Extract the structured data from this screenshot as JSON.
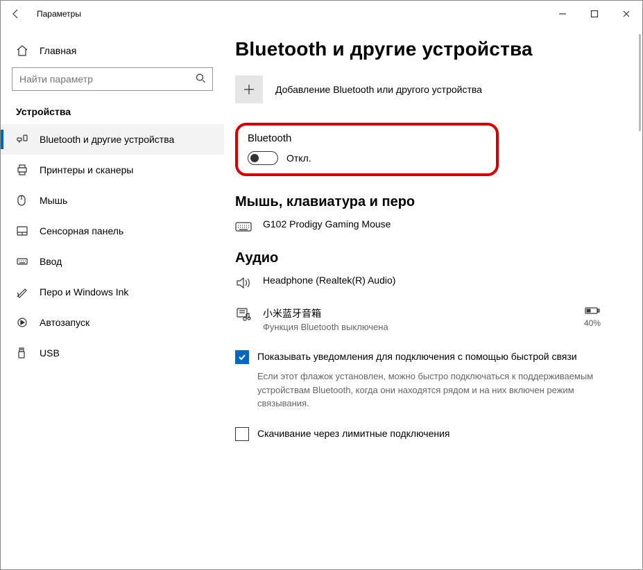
{
  "window": {
    "title": "Параметры"
  },
  "sidebar": {
    "home": "Главная",
    "search_placeholder": "Найти параметр",
    "section": "Устройства",
    "items": [
      {
        "label": "Bluetooth и другие устройства"
      },
      {
        "label": "Принтеры и сканеры"
      },
      {
        "label": "Мышь"
      },
      {
        "label": "Сенсорная панель"
      },
      {
        "label": "Ввод"
      },
      {
        "label": "Перо и Windows Ink"
      },
      {
        "label": "Автозапуск"
      },
      {
        "label": "USB"
      }
    ]
  },
  "main": {
    "title": "Bluetooth и другие устройства",
    "add_device": "Добавление Bluetooth или другого устройства",
    "bluetooth": {
      "heading": "Bluetooth",
      "state": "Откл."
    },
    "group_mkb": "Мышь, клавиатура и перо",
    "mouse_name": "G102 Prodigy Gaming Mouse",
    "group_audio": "Аудио",
    "headphone_name": "Headphone (Realtek(R) Audio)",
    "speaker_name": "小米蓝牙音箱",
    "speaker_sub": "Функция Bluetooth выключена",
    "speaker_battery": "40%",
    "notify_label": "Показывать уведомления для подключения с помощью быстрой связи",
    "notify_desc": "Если этот флажок установлен, можно быстро подключаться к поддерживаемым устройствам Bluetooth, когда они находятся рядом и на них включен режим связывания.",
    "metered_label": "Скачивание через лимитные подключения"
  }
}
